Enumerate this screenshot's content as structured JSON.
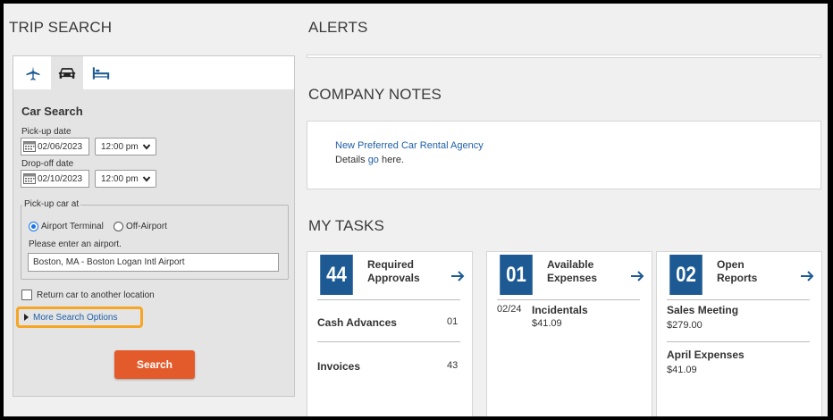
{
  "trip_search": {
    "title": "TRIP SEARCH",
    "tabs": [
      {
        "name": "airplane-icon",
        "active": false
      },
      {
        "name": "car-icon",
        "active": true
      },
      {
        "name": "hotel-bed-icon",
        "active": false
      }
    ],
    "heading": "Car Search",
    "pickup_date_label": "Pick-up date",
    "pickup_date": "02/06/2023",
    "pickup_time": "12:00 pm",
    "dropoff_date_label": "Drop-off date",
    "dropoff_date": "02/10/2023",
    "dropoff_time": "12:00 pm",
    "pickup_at_legend": "Pick-up car at",
    "radio_airport": "Airport Terminal",
    "radio_off_airport": "Off-Airport",
    "radio_selected": "Airport Terminal",
    "airport_prompt": "Please enter an airport.",
    "airport_value": "Boston, MA - Boston Logan Intl Airport",
    "return_other_label": "Return car to another location",
    "return_other_checked": false,
    "more_options_label": "More Search Options",
    "search_button": "Search"
  },
  "alerts": {
    "title": "ALERTS"
  },
  "company_notes": {
    "title": "COMPANY NOTES",
    "link_text": "New Preferred Car Rental Agency",
    "details_prefix": "Details ",
    "details_link": "go",
    "details_suffix": " here."
  },
  "tasks": {
    "title": "MY TASKS",
    "cards": [
      {
        "count": "44",
        "label_line1": "Required",
        "label_line2": "Approvals",
        "rows": [
          {
            "label": "Cash Advances",
            "count": "01"
          },
          {
            "label": "Invoices",
            "count": "43"
          }
        ]
      },
      {
        "count": "01",
        "label_line1": "Available",
        "label_line2": "Expenses",
        "rows": [
          {
            "date": "02/24",
            "label": "Incidentals",
            "amount": "$41.09"
          }
        ]
      },
      {
        "count": "02",
        "label_line1": "Open",
        "label_line2": "Reports",
        "rows": [
          {
            "label": "Sales Meeting",
            "amount": "$279.00"
          },
          {
            "label": "April Expenses",
            "amount": "$41.09"
          }
        ]
      }
    ]
  },
  "colors": {
    "brand_blue": "#1d5a93",
    "link_blue": "#1f5fa8",
    "search_orange": "#e35b2b",
    "highlight_orange": "#f6a623"
  }
}
